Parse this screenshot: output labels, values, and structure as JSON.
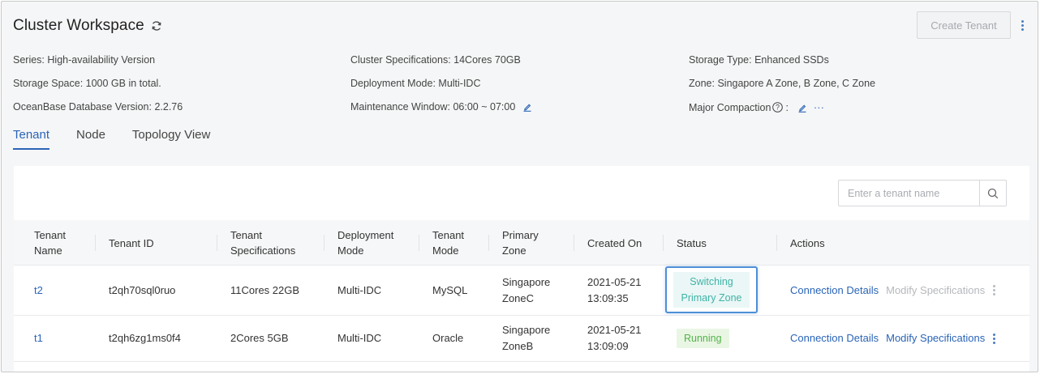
{
  "header": {
    "title": "Cluster Workspace",
    "create_label": "Create Tenant"
  },
  "info": {
    "series_label": "Series:",
    "series_value": "High-availability Version",
    "specs_label": "Cluster Specifications:",
    "specs_value": "14Cores 70GB",
    "storage_type_label": "Storage Type:",
    "storage_type_value": "Enhanced SSDs",
    "storage_space_label": "Storage Space:",
    "storage_space_value": "1000 GB in total.",
    "deployment_label": "Deployment Mode:",
    "deployment_value": "Multi-IDC",
    "zone_label": "Zone:",
    "zone_value": "Singapore A Zone, B Zone, C Zone",
    "version_label": "OceanBase Database Version:",
    "version_value": "2.2.76",
    "maintenance_label": "Maintenance Window:",
    "maintenance_value": "06:00 ~ 07:00",
    "compaction_label": "Major Compaction",
    "compaction_colon": ":",
    "compaction_more": "···"
  },
  "tabs": [
    {
      "label": "Tenant"
    },
    {
      "label": "Node"
    },
    {
      "label": "Topology View"
    }
  ],
  "search": {
    "placeholder": "Enter a tenant name"
  },
  "table": {
    "columns": [
      {
        "l1": "Tenant",
        "l2": "Name"
      },
      {
        "l1": "Tenant ID",
        "l2": ""
      },
      {
        "l1": "Tenant",
        "l2": "Specifications"
      },
      {
        "l1": "Deployment",
        "l2": "Mode"
      },
      {
        "l1": "Tenant",
        "l2": "Mode"
      },
      {
        "l1": "Primary",
        "l2": "Zone"
      },
      {
        "l1": "Created On",
        "l2": ""
      },
      {
        "l1": "Status",
        "l2": ""
      },
      {
        "l1": "Actions",
        "l2": ""
      }
    ],
    "rows": [
      {
        "name": "t2",
        "id": "t2qh70sql0ruo",
        "specs": "11Cores 22GB",
        "deploy": "Multi-IDC",
        "mode": "MySQL",
        "zone1": "Singapore",
        "zone2": "ZoneC",
        "date": "2021-05-21",
        "time": "13:09:35",
        "status1": "Switching",
        "status2": "Primary Zone",
        "action1": "Connection Details",
        "action2": "Modify Specifications"
      },
      {
        "name": "t1",
        "id": "t2qh6zg1ms0f4",
        "specs": "2Cores 5GB",
        "deploy": "Multi-IDC",
        "mode": "Oracle",
        "zone1": "Singapore",
        "zone2": "ZoneB",
        "date": "2021-05-21",
        "time": "13:09:09",
        "status1": "Running",
        "action1": "Connection Details",
        "action2": "Modify Specifications"
      }
    ]
  },
  "colors": {
    "accent": "#2a64b7",
    "switching": "#3fb3a6",
    "running": "#52b34a",
    "highlight": "#4d8fd6"
  }
}
